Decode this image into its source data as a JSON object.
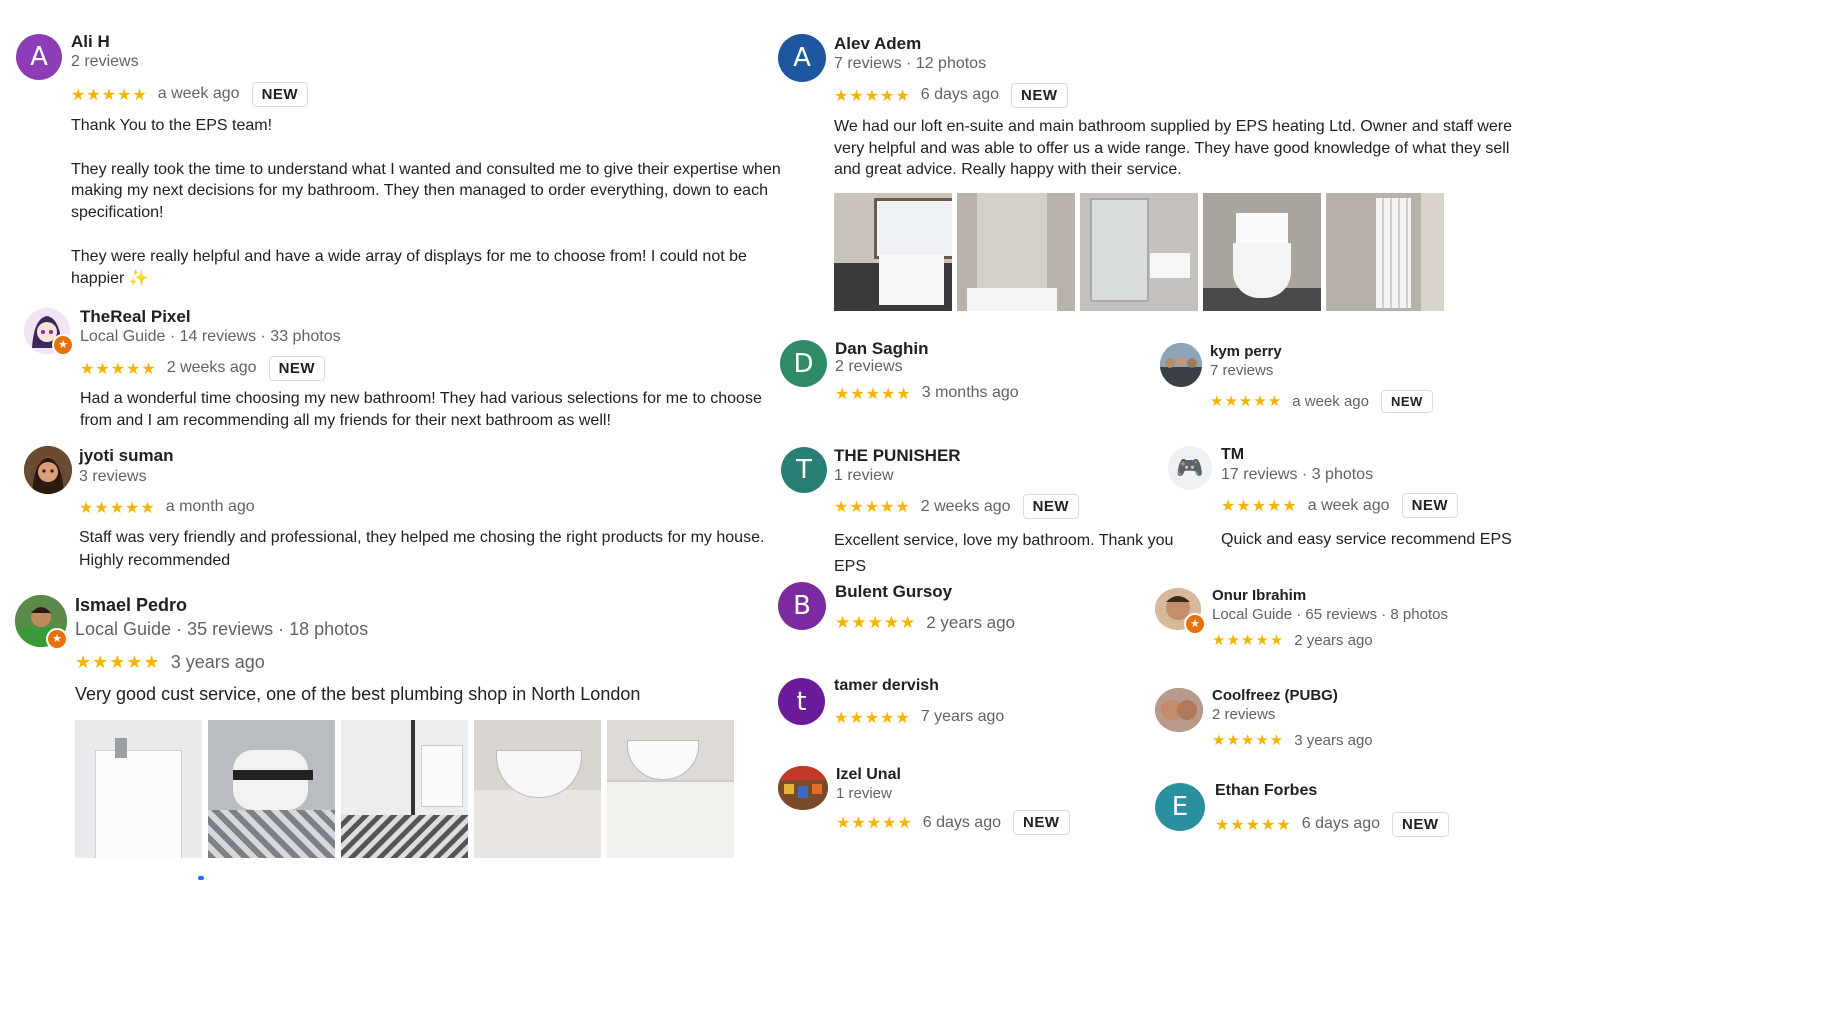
{
  "reviews": [
    {
      "name": "Ali H",
      "meta": "2 reviews",
      "stars": "★★★★★",
      "date": "a week ago",
      "badge": "NEW",
      "initial": "A",
      "text": "Thank You to the EPS team!\n\nThey really took the time to understand what I wanted and consulted me to give their expertise when making my next decisions for my bathroom. They then managed to order everything, down to each specification!\n\nThey were really helpful and have a wide array of displays for me to choose from! I could not be happier ✨"
    },
    {
      "name": "TheReal Pixel",
      "meta": "Local Guide · 14 reviews · 33 photos",
      "stars": "★★★★★",
      "date": "2 weeks ago",
      "badge": "NEW",
      "text": "Had a wonderful time choosing my new bathroom! They had various selections for me to choose from and I am recommending all my friends for their next bathroom as well!"
    },
    {
      "name": "jyoti suman",
      "meta": "3 reviews",
      "stars": "★★★★★",
      "date": "a month ago",
      "text": "Staff was very friendly and professional, they helped me chosing  the right products for my house. Highly recommended"
    },
    {
      "name": "Ismael Pedro",
      "meta": "Local Guide · 35 reviews · 18 photos",
      "stars": "★★★★★",
      "date": "3 years ago",
      "text": "Very good cust service, one of the best plumbing shop in North London"
    },
    {
      "name": "Alev Adem",
      "meta": "7 reviews · 12 photos",
      "stars": "★★★★★",
      "date": "6 days ago",
      "badge": "NEW",
      "initial": "A",
      "text": "We had our loft en-suite and main bathroom supplied by EPS heating Ltd. Owner and staff were very helpful and was able to offer us a wide range. They have good knowledge of what they sell and great advice. Really happy with their service."
    },
    {
      "name": "Dan Saghin",
      "meta": "2 reviews",
      "stars": "★★★★★",
      "date": "3 months ago",
      "initial": "D"
    },
    {
      "name": "kym perry",
      "meta": "7 reviews",
      "stars": "★★★★★",
      "date": "a week ago",
      "badge": "NEW"
    },
    {
      "name": "THE PUNISHER",
      "meta": "1 review",
      "stars": "★★★★★",
      "date": "2 weeks ago",
      "badge": "NEW",
      "initial": "T",
      "text": "Excellent service, love my bathroom. Thank you EPS"
    },
    {
      "name": "TM",
      "meta": "17 reviews · 3 photos",
      "stars": "★★★★★",
      "date": "a week ago",
      "badge": "NEW",
      "text": "Quick and easy service recommend EPS"
    },
    {
      "name": "Bulent Gursoy",
      "stars": "★★★★★",
      "date": "2 years ago",
      "initial": "B"
    },
    {
      "name": "Onur Ibrahim",
      "meta": "Local Guide · 65 reviews · 8 photos",
      "stars": "★★★★★",
      "date": "2 years ago"
    },
    {
      "name": "tamer dervish",
      "stars": "★★★★★",
      "date": "7 years ago",
      "initial": "t"
    },
    {
      "name": "Coolfreez (PUBG)",
      "meta": "2 reviews",
      "stars": "★★★★★",
      "date": "3 years ago"
    },
    {
      "name": "Izel Unal",
      "meta": "1 review",
      "stars": "★★★★★",
      "date": "6 days ago",
      "badge": "NEW"
    },
    {
      "name": "Ethan Forbes",
      "stars": "★★★★★",
      "date": "6 days ago",
      "badge": "NEW",
      "initial": "E"
    }
  ],
  "avatar_colors": {
    "ali": "#8e3cb5",
    "alev": "#1e57a0",
    "dan": "#2f8a66",
    "punisher": "#2a7f74",
    "bulent": "#7b2ba0",
    "tamer": "#6a1b9a",
    "ethan": "#2a8f9e"
  },
  "icons": {
    "gamepad": "🎮",
    "local_guide": "★"
  }
}
